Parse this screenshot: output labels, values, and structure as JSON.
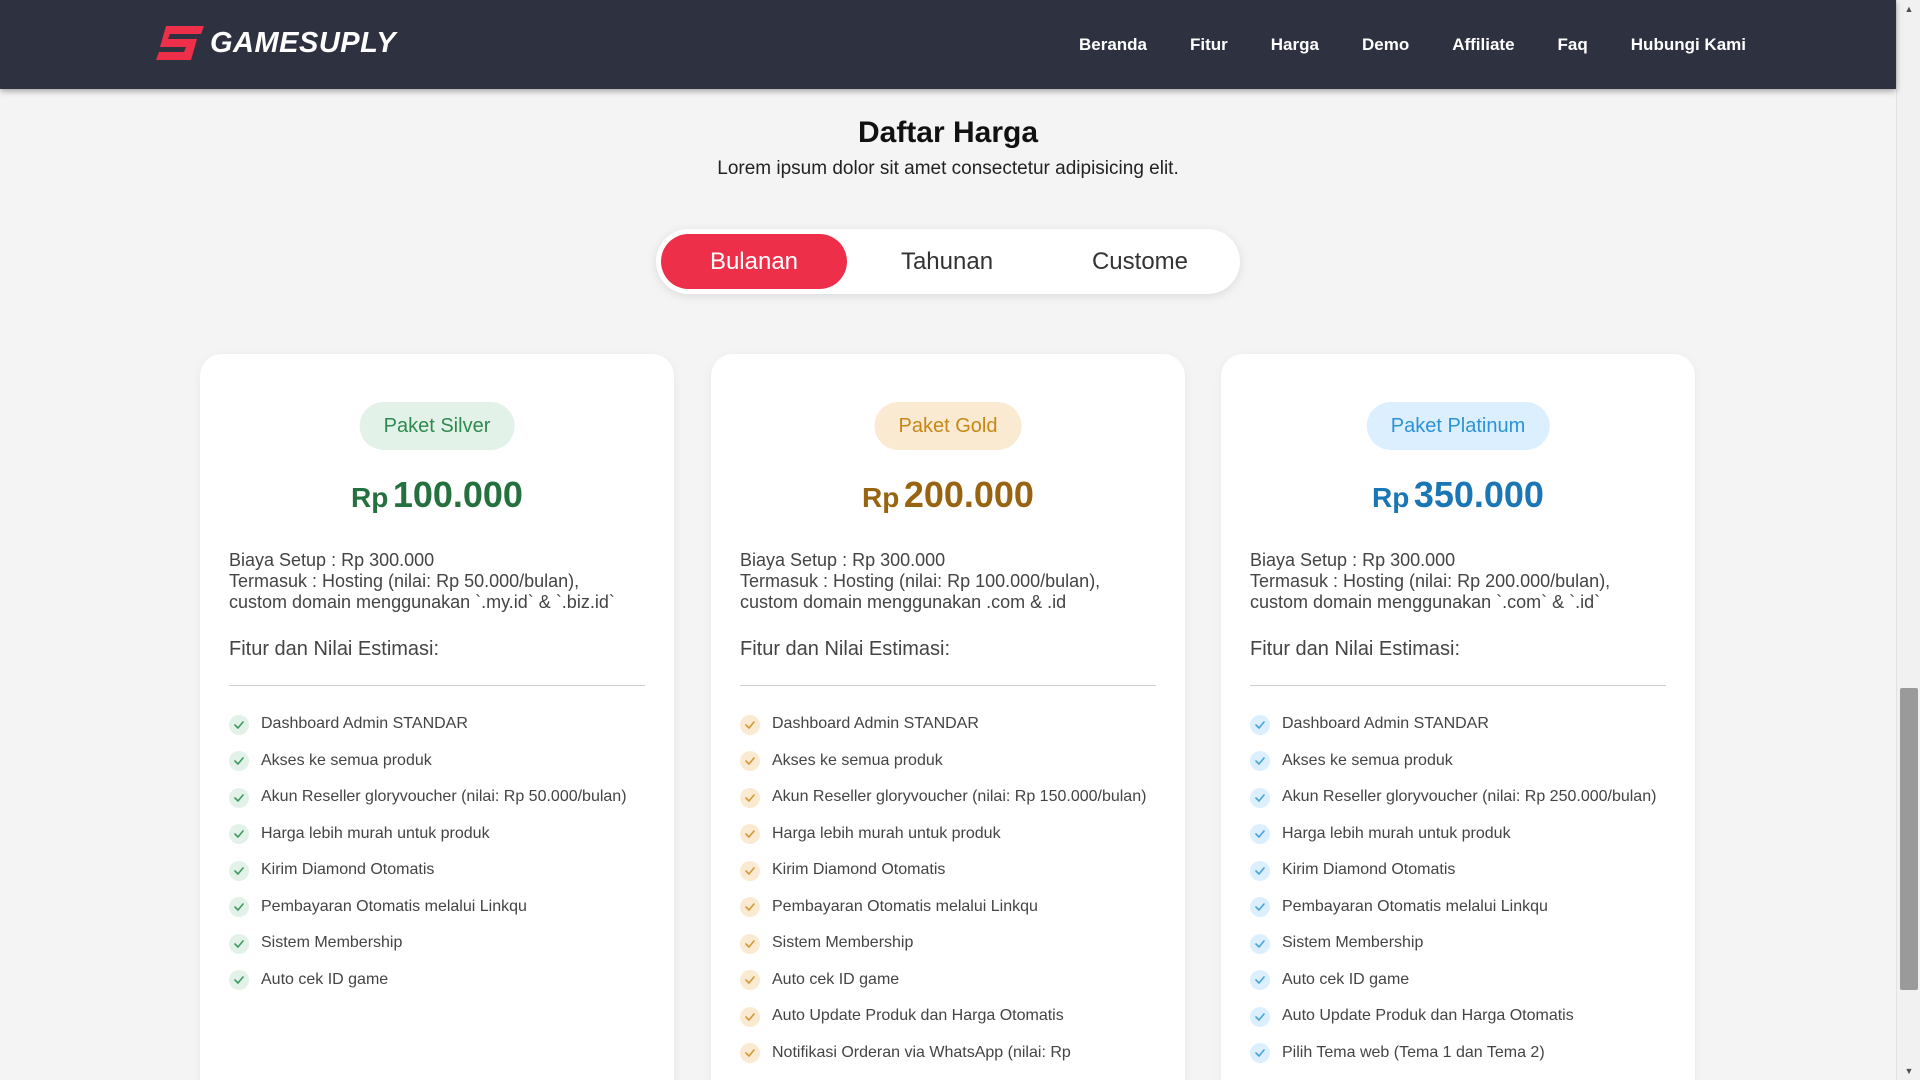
{
  "navbar": {
    "brand": "GAMESUPLY",
    "links": [
      "Beranda",
      "Fitur",
      "Harga",
      "Demo",
      "Affiliate",
      "Faq",
      "Hubungi Kami"
    ]
  },
  "section": {
    "title": "Daftar Harga",
    "subtitle": "Lorem ipsum dolor sit amet consectetur adipisicing elit."
  },
  "toggle": {
    "options": [
      "Bulanan",
      "Tahunan",
      "Custome"
    ],
    "active": "Bulanan"
  },
  "colors": {
    "navbar": "#2e3140",
    "accent": "#ee2f49",
    "silver": "#24703f",
    "gold": "#986411",
    "platinum": "#1a76b4"
  },
  "plans": [
    {
      "badge": "Paket Silver",
      "currency": "Rp",
      "price": "100.000",
      "setup": "Biaya Setup : Rp 300.000",
      "includes": "Termasuk : Hosting (nilai: Rp 50.000/bulan),\ncustom domain menggunakan `.my.id` & `.biz.id`",
      "features_title": "Fitur dan Nilai Estimasi:",
      "features": [
        "Dashboard Admin STANDAR",
        "Akses ke semua produk",
        "Akun Reseller gloryvoucher (nilai: Rp 50.000/bulan)",
        "Harga lebih murah untuk produk",
        "Kirim Diamond Otomatis",
        "Pembayaran Otomatis melalui Linkqu",
        "Sistem Membership",
        "Auto cek ID game"
      ]
    },
    {
      "badge": "Paket Gold",
      "currency": "Rp",
      "price": "200.000",
      "setup": "Biaya Setup : Rp 300.000",
      "includes": "Termasuk : Hosting (nilai: Rp 100.000/bulan),\ncustom domain menggunakan .com & .id",
      "features_title": "Fitur dan Nilai Estimasi:",
      "features": [
        "Dashboard Admin STANDAR",
        "Akses ke semua produk",
        "Akun Reseller gloryvoucher (nilai: Rp 150.000/bulan)",
        "Harga lebih murah untuk produk",
        "Kirim Diamond Otomatis",
        "Pembayaran Otomatis melalui Linkqu",
        "Sistem Membership",
        "Auto cek ID game",
        "Auto Update Produk dan Harga Otomatis",
        "Notifikasi Orderan via WhatsApp (nilai: Rp"
      ]
    },
    {
      "badge": "Paket Platinum",
      "currency": "Rp",
      "price": "350.000",
      "setup": "Biaya Setup : Rp 300.000",
      "includes": "Termasuk : Hosting (nilai: Rp 200.000/bulan),\ncustom domain menggunakan `.com` & `.id`",
      "features_title": "Fitur dan Nilai Estimasi:",
      "features": [
        "Dashboard Admin STANDAR",
        "Akses ke semua produk",
        "Akun Reseller gloryvoucher (nilai: Rp 250.000/bulan)",
        "Harga lebih murah untuk produk",
        "Kirim Diamond Otomatis",
        "Pembayaran Otomatis melalui Linkqu",
        "Sistem Membership",
        "Auto cek ID game",
        "Auto Update Produk dan Harga Otomatis",
        "Pilih Tema web (Tema 1 dan Tema 2)"
      ]
    }
  ]
}
